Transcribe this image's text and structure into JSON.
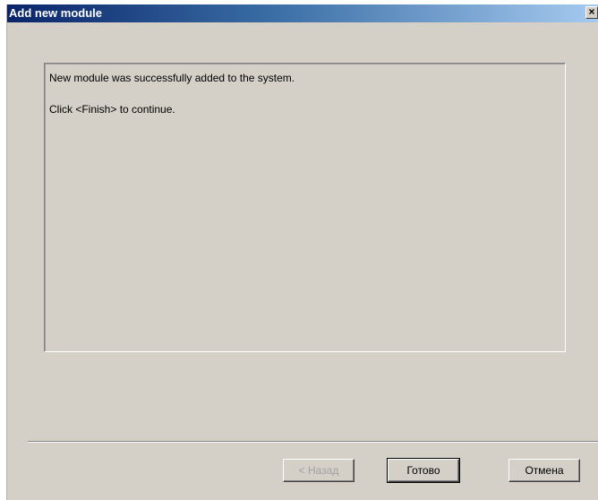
{
  "window": {
    "title": "Add new module",
    "close_label": "×"
  },
  "message": {
    "line1": "New module was successfully added to the system.",
    "line2": "Click <Finish> to continue."
  },
  "buttons": {
    "back_label": "< Назад",
    "finish_label": "Готово",
    "cancel_label": "Отмена"
  },
  "colors": {
    "titlebar_start": "#0a246a",
    "titlebar_end": "#a6caf0",
    "dialog_face": "#d4d0c8",
    "disabled_text": "#a0a0a0"
  }
}
